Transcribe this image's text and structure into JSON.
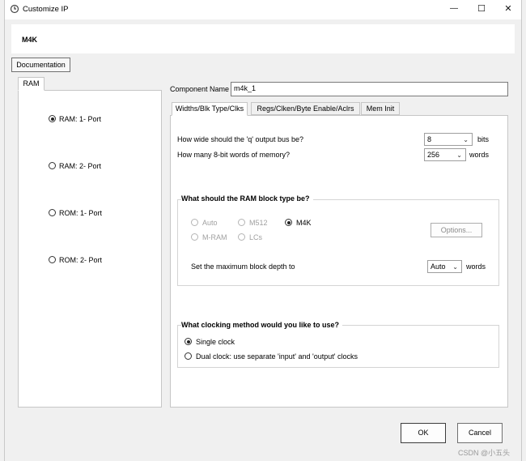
{
  "window": {
    "title": "Customize IP",
    "controls": {
      "minimize": "—",
      "maximize": "☐",
      "close": "✕"
    }
  },
  "header": {
    "title": "M4K"
  },
  "documentation_button": "Documentation",
  "left_panel": {
    "tab_label": "RAM",
    "options": [
      {
        "label": "RAM:  1- Port",
        "checked": true
      },
      {
        "label": "RAM:  2- Port",
        "checked": false
      },
      {
        "label": "ROM:  1- Port",
        "checked": false
      },
      {
        "label": "ROM:  2- Port",
        "checked": false
      }
    ]
  },
  "component": {
    "label": "Component Name",
    "value": "m4k_1"
  },
  "tabs": [
    {
      "label": "Widths/Blk Type/Clks",
      "active": true
    },
    {
      "label": "Regs/Clken/Byte Enable/Aclrs",
      "active": false
    },
    {
      "label": "Mem Init",
      "active": false
    }
  ],
  "widths": {
    "q_bus_question": "How wide should the 'q' output bus be?",
    "q_bus_value": "8",
    "q_bus_unit": "bits",
    "words_question": "How many 8-bit words of memory?",
    "words_value": "256",
    "words_unit": "words"
  },
  "block_type": {
    "title": "What should the RAM block type be?",
    "options": [
      {
        "label": "Auto",
        "checked": false,
        "disabled": true
      },
      {
        "label": "M512",
        "checked": false,
        "disabled": true
      },
      {
        "label": "M4K",
        "checked": true,
        "disabled": false
      },
      {
        "label": "M-RAM",
        "checked": false,
        "disabled": true
      },
      {
        "label": "LCs",
        "checked": false,
        "disabled": true
      }
    ],
    "options_button": "Options...",
    "depth_label": "Set the maximum block depth to",
    "depth_value": "Auto",
    "depth_unit": "words"
  },
  "clocking": {
    "title": "What clocking method would you like to use?",
    "options": [
      {
        "label": "Single clock",
        "checked": true
      },
      {
        "label": "Dual clock: use separate 'input' and 'output' clocks",
        "checked": false
      }
    ]
  },
  "footer": {
    "ok": "OK",
    "cancel": "Cancel",
    "watermark": "CSDN @小五头"
  },
  "colors": {
    "dialog_bg": "#f0f0f0",
    "panel_bg": "#ffffff",
    "border": "#c6c6c6",
    "disabled_text": "#a0a0a0"
  }
}
